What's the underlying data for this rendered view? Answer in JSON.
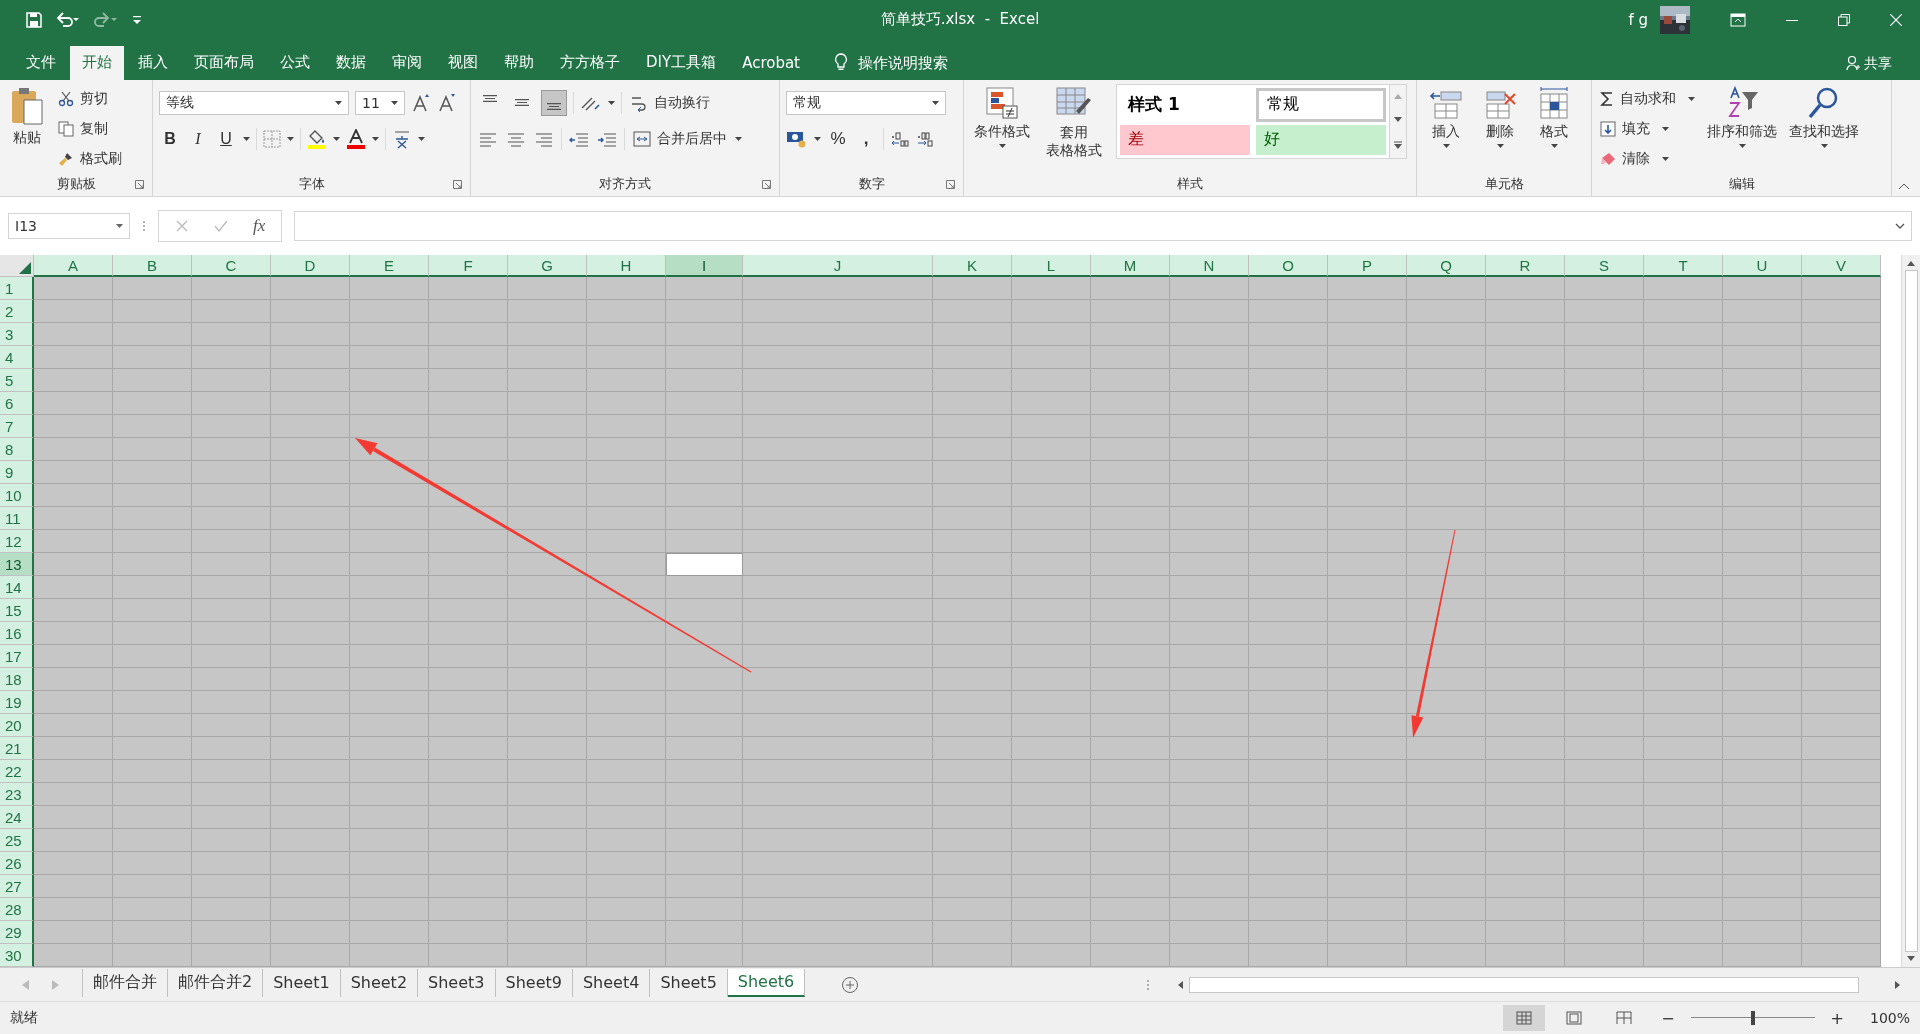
{
  "title_bar": {
    "title": "简单技巧.xlsx  -  Excel",
    "user": "f g"
  },
  "ribbon_tabs": [
    {
      "label": "文件",
      "selected": false
    },
    {
      "label": "开始",
      "selected": true
    },
    {
      "label": "插入",
      "selected": false
    },
    {
      "label": "页面布局",
      "selected": false
    },
    {
      "label": "公式",
      "selected": false
    },
    {
      "label": "数据",
      "selected": false
    },
    {
      "label": "审阅",
      "selected": false
    },
    {
      "label": "视图",
      "selected": false
    },
    {
      "label": "帮助",
      "selected": false
    },
    {
      "label": "方方格子",
      "selected": false
    },
    {
      "label": "DIY工具箱",
      "selected": false
    },
    {
      "label": "Acrobat",
      "selected": false
    }
  ],
  "tell_me": "操作说明搜索",
  "share": "共享",
  "ribbon": {
    "clipboard": {
      "label": "剪贴板",
      "paste": "粘贴",
      "cut": "剪切",
      "copy": "复制",
      "format_painter": "格式刷"
    },
    "font": {
      "label": "字体",
      "font_name": "等线",
      "font_size": "11",
      "bold": "B",
      "italic": "I",
      "underline": "U"
    },
    "alignment": {
      "label": "对齐方式",
      "vertical_align": [
        {
          "selected": false
        },
        {
          "selected": false
        },
        {
          "selected": true
        }
      ],
      "wrap_text": "自动换行",
      "merge_center": "合并后居中"
    },
    "number": {
      "label": "数字",
      "format": "常规",
      "percent": "%",
      "comma": ","
    },
    "styles": {
      "label": "样式",
      "conditional": "条件格式",
      "table_line1": "套用",
      "table_line2": "表格格式",
      "gallery": [
        {
          "label": "样式 1",
          "kind": "bold",
          "selected": false
        },
        {
          "label": "常规",
          "kind": "normal",
          "selected": true
        },
        {
          "label": "差",
          "kind": "bad",
          "selected": false
        },
        {
          "label": "好",
          "kind": "good",
          "selected": false
        }
      ]
    },
    "cells": {
      "label": "单元格",
      "insert": "插入",
      "delete": "删除",
      "format": "格式"
    },
    "editing": {
      "label": "编辑",
      "autosum": "自动求和",
      "fill": "填充",
      "clear": "清除",
      "sort_filter": "排序和筛选",
      "find_select": "查找和选择"
    }
  },
  "formula_bar": {
    "name_box": "I13",
    "fx": "fx"
  },
  "grid": {
    "all_selected": true,
    "columns": [
      {
        "label": "A",
        "active": false
      },
      {
        "label": "B",
        "active": false
      },
      {
        "label": "C",
        "active": false
      },
      {
        "label": "D",
        "active": false
      },
      {
        "label": "E",
        "active": false
      },
      {
        "label": "F",
        "active": false
      },
      {
        "label": "G",
        "active": false
      },
      {
        "label": "H",
        "active": false
      },
      {
        "label": "I",
        "active": true
      },
      {
        "label": "J",
        "active": false
      },
      {
        "label": "K",
        "active": false
      },
      {
        "label": "L",
        "active": false
      },
      {
        "label": "M",
        "active": false
      },
      {
        "label": "N",
        "active": false
      },
      {
        "label": "O",
        "active": false
      },
      {
        "label": "P",
        "active": false
      },
      {
        "label": "Q",
        "active": false
      },
      {
        "label": "R",
        "active": false
      },
      {
        "label": "S",
        "active": false
      },
      {
        "label": "T",
        "active": false
      },
      {
        "label": "U",
        "active": false
      },
      {
        "label": "V",
        "active": false
      }
    ],
    "rows": [
      {
        "label": "1",
        "active": false
      },
      {
        "label": "2",
        "active": false
      },
      {
        "label": "3",
        "active": false
      },
      {
        "label": "4",
        "active": false
      },
      {
        "label": "5",
        "active": false
      },
      {
        "label": "6",
        "active": false
      },
      {
        "label": "7",
        "active": false
      },
      {
        "label": "8",
        "active": false
      },
      {
        "label": "9",
        "active": false
      },
      {
        "label": "10",
        "active": false
      },
      {
        "label": "11",
        "active": false
      },
      {
        "label": "12",
        "active": false
      },
      {
        "label": "13",
        "active": true
      },
      {
        "label": "14",
        "active": false
      },
      {
        "label": "15",
        "active": false
      },
      {
        "label": "16",
        "active": false
      },
      {
        "label": "17",
        "active": false
      },
      {
        "label": "18",
        "active": false
      },
      {
        "label": "19",
        "active": false
      },
      {
        "label": "20",
        "active": false
      },
      {
        "label": "21",
        "active": false
      },
      {
        "label": "22",
        "active": false
      },
      {
        "label": "23",
        "active": false
      },
      {
        "label": "24",
        "active": false
      },
      {
        "label": "25",
        "active": false
      },
      {
        "label": "26",
        "active": false
      },
      {
        "label": "27",
        "active": false
      },
      {
        "label": "28",
        "active": false
      },
      {
        "label": "29",
        "active": false
      },
      {
        "label": "30",
        "active": false
      }
    ]
  },
  "sheet_tabs": [
    {
      "label": "邮件合并",
      "selected": false
    },
    {
      "label": "邮件合并2",
      "selected": false
    },
    {
      "label": "Sheet1",
      "selected": false
    },
    {
      "label": "Sheet2",
      "selected": false
    },
    {
      "label": "Sheet3",
      "selected": false
    },
    {
      "label": "Sheet9",
      "selected": false
    },
    {
      "label": "Sheet4",
      "selected": false
    },
    {
      "label": "Sheet5",
      "selected": false
    },
    {
      "label": "Sheet6",
      "selected": true
    }
  ],
  "status_bar": {
    "text": "就绪",
    "zoom_minus": "−",
    "zoom_plus": "+",
    "zoom": "100%",
    "zoom_slider": {
      "level": 0.5
    }
  }
}
